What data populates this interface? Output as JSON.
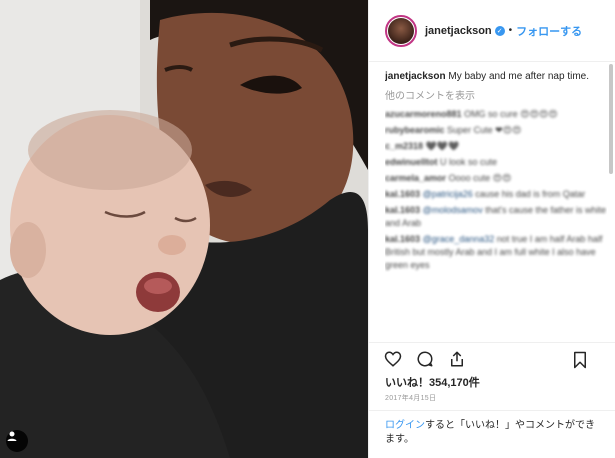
{
  "post": {
    "username": "janetjackson",
    "follow_label": "フォローする",
    "dot": "•",
    "caption_text": "My baby and me after nap time.",
    "more_comments": "他のコメントを表示",
    "comments": [
      {
        "user": "azucarmoreno881",
        "text": "OMG so cure 😍😍😍😍"
      },
      {
        "user": "rubybearomic",
        "text": "Super Cute ❤😍😍"
      },
      {
        "user": "c_m2318",
        "text": "🖤🖤🖤"
      },
      {
        "user": "edwinuelltot",
        "text": "U look so cute"
      },
      {
        "user": "carmela_amor",
        "text": "Oooo cute 😍😍"
      },
      {
        "user": "kal.1603",
        "mention": "@patricija26",
        "text": "cause his dad is from Qatar"
      },
      {
        "user": "kal.1603",
        "mention": "@molodsamov",
        "text": "that's cause the father is white and Arab"
      },
      {
        "user": "kal.1603",
        "mention": "@grace_danna32",
        "text": "not true I am half Arab half British but mostly Arab and I am full white I also have green eyes"
      }
    ],
    "likes": "いいね！354,170件",
    "date": "2017年4月15日",
    "login_link": "ログイン",
    "login_text": "すると「いいね！」やコメントができます。"
  },
  "icons": [
    "heart-icon",
    "comment-icon",
    "share-icon",
    "bookmark-icon",
    "user-tag-icon",
    "verified-badge-icon"
  ]
}
